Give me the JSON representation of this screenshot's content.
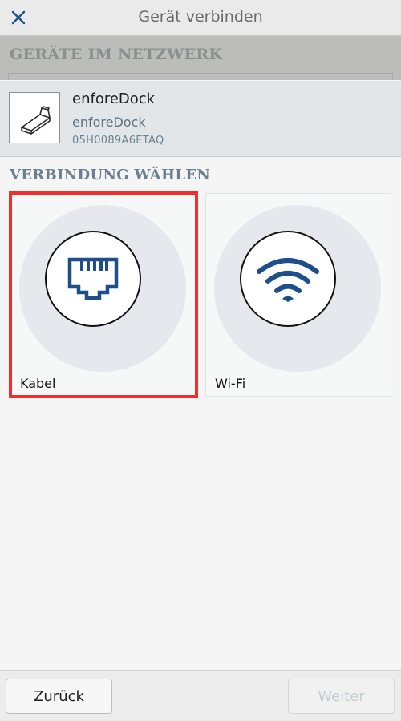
{
  "header": {
    "title": "Gerät verbinden",
    "close_icon": "close-icon",
    "accent_color": "#1f4f8a"
  },
  "network_section": {
    "heading": "GERÄTE IM NETZWERK"
  },
  "device": {
    "name": "enforeDock",
    "type": "enforeDock",
    "serial": "05H0089A6ETAQ",
    "icon": "dock-device-icon"
  },
  "connection_section": {
    "heading": "VERBINDUNG WÄHLEN"
  },
  "options": [
    {
      "label": "Kabel",
      "icon": "ethernet-port-icon",
      "selected": true
    },
    {
      "label": "Wi-Fi",
      "icon": "wifi-icon",
      "selected": false
    }
  ],
  "footer": {
    "back_label": "Zurück",
    "next_label": "Weiter",
    "next_enabled": false
  },
  "colors": {
    "selection_outline": "#ee2f2b",
    "icon_blue": "#1f4f8a"
  }
}
